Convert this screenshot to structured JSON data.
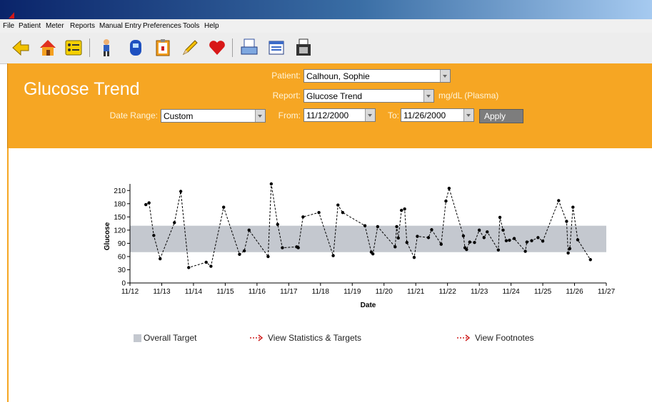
{
  "menu": {
    "items": [
      "File",
      "Patient",
      "Meter",
      "Reports",
      "Manual Entry",
      "Preferences",
      "Tools",
      "Help"
    ]
  },
  "toolbar": {
    "icons": [
      "back-arrow-icon",
      "home-icon",
      "list-icon",
      "person-icon",
      "meter-device-icon",
      "clipboard-icon",
      "pencil-icon",
      "heart-icon",
      "printer-icon",
      "document-icon",
      "fax-icon"
    ]
  },
  "header": {
    "title": "Glucose Trend",
    "patient_label": "Patient:",
    "patient_value": "Calhoun, Sophie",
    "report_label": "Report:",
    "report_value": "Glucose Trend",
    "units": "mg/dL (Plasma)",
    "date_range_label": "Date Range:",
    "date_range_value": "Custom",
    "from_label": "From:",
    "from_value": "11/12/2000",
    "to_label": "To:",
    "to_value": "11/26/2000",
    "apply_label": "Apply",
    "colors": {
      "band": "#f6a623"
    }
  },
  "legend": {
    "target_label": "Overall Target",
    "stats_link": "View Statistics & Targets",
    "footnotes_link": "View Footnotes"
  },
  "chart_data": {
    "type": "line",
    "title": "",
    "xlabel": "Date",
    "ylabel": "Glucose",
    "x_ticks": [
      "11/12",
      "11/13",
      "11/14",
      "11/15",
      "11/16",
      "11/17",
      "11/18",
      "11/19",
      "11/20",
      "11/21",
      "11/22",
      "11/23",
      "11/24",
      "11/25",
      "11/26",
      "11/27"
    ],
    "y_ticks": [
      0,
      30,
      60,
      90,
      120,
      150,
      180,
      210
    ],
    "xlim_days": [
      12,
      27
    ],
    "ylim": [
      0,
      225
    ],
    "target_band": [
      70,
      130
    ],
    "grid": false,
    "colors": {
      "line": "#000000",
      "target": "#c4c8cf"
    },
    "series": [
      {
        "x": [
          12.5,
          12.6,
          12.75,
          12.95,
          13.4,
          13.6,
          13.85,
          14.4,
          14.55,
          14.95,
          15.45,
          15.6,
          15.75,
          16.35,
          16.45,
          16.65,
          16.8,
          17.25,
          17.3,
          17.45,
          17.95,
          18.4,
          18.55,
          18.7,
          19.4,
          19.6,
          19.65,
          19.8,
          20.35,
          20.4,
          20.45,
          20.55,
          20.65,
          20.72,
          20.95,
          21.05,
          21.4,
          21.5,
          21.8,
          21.95,
          22.05,
          22.5,
          22.55,
          22.6,
          22.7,
          22.85,
          23.0,
          23.15,
          23.25,
          23.6,
          23.65,
          23.75,
          23.85,
          23.95,
          24.1,
          24.45,
          24.5,
          24.65,
          24.85,
          25.0,
          25.5,
          25.75,
          25.8,
          25.85,
          25.95,
          26.1,
          26.5
        ],
        "y": [
          178,
          182,
          108,
          55,
          137,
          208,
          35,
          47,
          38,
          172,
          65,
          73,
          120,
          60,
          225,
          133,
          80,
          82,
          80,
          150,
          160,
          62,
          177,
          160,
          130,
          70,
          66,
          128,
          82,
          128,
          102,
          165,
          168,
          92,
          58,
          106,
          103,
          121,
          88,
          186,
          215,
          107,
          80,
          76,
          93,
          92,
          120,
          103,
          116,
          75,
          149,
          120,
          96,
          97,
          101,
          72,
          93,
          96,
          103,
          95,
          187,
          140,
          68,
          78,
          172,
          98,
          53
        ]
      }
    ]
  }
}
